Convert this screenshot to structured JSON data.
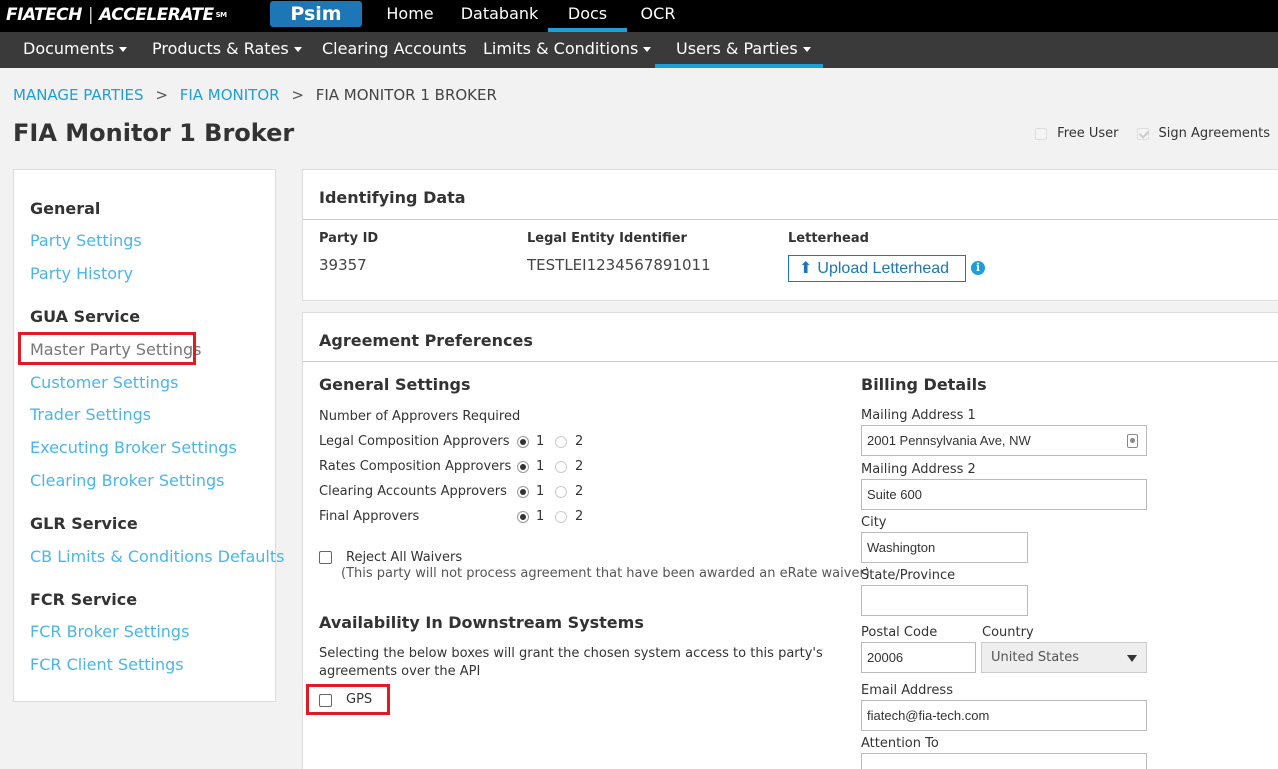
{
  "brand": {
    "logo_left": "FIATECH",
    "logo_sep": "|",
    "logo_right": "ACCELERATE",
    "logo_mark": "SM",
    "product": "Psim"
  },
  "top_nav": {
    "items": [
      {
        "label": "Home",
        "active": false
      },
      {
        "label": "Databank",
        "active": false
      },
      {
        "label": "Docs",
        "active": true
      },
      {
        "label": "OCR",
        "active": false
      }
    ]
  },
  "sub_nav": {
    "items": [
      {
        "label": "Documents",
        "dropdown": true,
        "active": false
      },
      {
        "label": "Products & Rates",
        "dropdown": true,
        "active": false
      },
      {
        "label": "Clearing Accounts",
        "dropdown": false,
        "active": false
      },
      {
        "label": "Limits & Conditions",
        "dropdown": true,
        "active": false
      },
      {
        "label": "Users & Parties",
        "dropdown": true,
        "active": true
      }
    ]
  },
  "breadcrumb": {
    "items": [
      "MANAGE PARTIES",
      "FIA MONITOR",
      "FIA MONITOR 1 BROKER"
    ],
    "separator": ">"
  },
  "page_title": "FIA Monitor 1 Broker",
  "header_checks": {
    "free_user": {
      "label": "Free User",
      "checked": false
    },
    "sign_agreements": {
      "label": "Sign Agreements",
      "checked": true
    }
  },
  "sidebar": {
    "general_heading": "General",
    "party_settings": "Party Settings",
    "party_history": "Party History",
    "gua_heading": "GUA Service",
    "master_party_settings": "Master Party Settings",
    "customer_settings": "Customer Settings",
    "trader_settings": "Trader Settings",
    "executing_broker_settings": "Executing Broker Settings",
    "clearing_broker_settings": "Clearing Broker Settings",
    "glr_heading": "GLR Service",
    "cb_limits": "CB Limits & Conditions Defaults",
    "fcr_heading": "FCR Service",
    "fcr_broker_settings": "FCR Broker Settings",
    "fcr_client_settings": "FCR Client Settings"
  },
  "identifying_data": {
    "title": "Identifying Data",
    "party_id_label": "Party ID",
    "party_id_value": "39357",
    "lei_label": "Legal Entity Identifier",
    "lei_value": "TESTLEI1234567891011",
    "letterhead_label": "Letterhead",
    "upload_button": "Upload Letterhead",
    "info_glyph": "i"
  },
  "agreement_preferences": {
    "title": "Agreement Preferences",
    "general_settings": {
      "heading": "General Settings",
      "approvers_required_label": "Number of Approvers Required",
      "rows": [
        {
          "label": "Legal Composition Approvers",
          "option1": "1",
          "option2": "2",
          "selected": "1"
        },
        {
          "label": "Rates Composition Approvers",
          "option1": "1",
          "option2": "2",
          "selected": "1"
        },
        {
          "label": "Clearing Accounts Approvers",
          "option1": "1",
          "option2": "2",
          "selected": "1"
        },
        {
          "label": "Final Approvers",
          "option1": "1",
          "option2": "2",
          "selected": "1"
        }
      ],
      "reject_waivers_label": "Reject All Waivers",
      "reject_waivers_note": "(This party will not process agreement that have been awarded an eRate waiver)",
      "reject_waivers_checked": false
    },
    "downstream": {
      "heading": "Availability In Downstream Systems",
      "description_line1": "Selecting the below boxes will grant the chosen system access to this party's",
      "description_line2": "agreements over the API",
      "gps_label": "GPS",
      "gps_checked": false
    },
    "billing": {
      "heading": "Billing Details",
      "mailing1_label": "Mailing Address 1",
      "mailing1_value": "2001 Pennsylvania Ave, NW",
      "mailing2_label": "Mailing Address 2",
      "mailing2_value": "Suite 600",
      "city_label": "City",
      "city_value": "Washington",
      "state_label": "State/Province",
      "state_value": "",
      "postal_label": "Postal Code",
      "postal_value": "20006",
      "country_label": "Country",
      "country_value": "United States",
      "email_label": "Email Address",
      "email_value": "fiatech@fia-tech.com",
      "attention_label": "Attention To",
      "attention_value": ""
    }
  },
  "colors": {
    "accent": "#1d9fd9",
    "brand_button": "#1d76b6",
    "highlight": "#e01b24",
    "link": "#4ab6e8"
  }
}
